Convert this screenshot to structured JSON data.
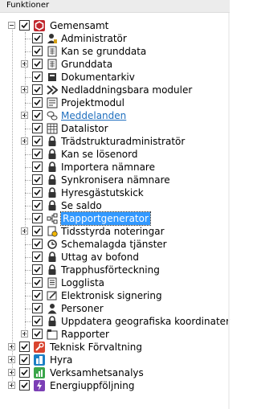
{
  "panel": {
    "title": "Funktioner"
  },
  "tree": {
    "root": {
      "label": "Gemensamt",
      "icon": "gemensamt-icon"
    },
    "children": [
      {
        "label": "Administratör",
        "icon": "admin-user-icon"
      },
      {
        "label": "Kan se grunddata",
        "icon": "document-grid-icon"
      },
      {
        "label": "Grunddata",
        "icon": "document-grid-icon"
      },
      {
        "label": "Dokumentarkiv",
        "icon": "archive-book-icon"
      },
      {
        "label": "Nedladdningsbara moduler",
        "icon": "download-arrow-icon"
      },
      {
        "label": "Projektmodul",
        "icon": "project-list-icon"
      },
      {
        "label": "Meddelanden",
        "icon": "message-bubbles-icon"
      },
      {
        "label": "Datalistor",
        "icon": "table-grid-icon"
      },
      {
        "label": "Trädstrukturadministratör",
        "icon": "lock-icon"
      },
      {
        "label": "Kan se lösenord",
        "icon": "lock-icon"
      },
      {
        "label": "Importera nämnare",
        "icon": "lock-icon"
      },
      {
        "label": "Synkronisera nämnare",
        "icon": "lock-icon"
      },
      {
        "label": "Hyresgästutskick",
        "icon": "lock-icon"
      },
      {
        "label": "Se saldo",
        "icon": "lock-icon"
      },
      {
        "label": "Rapportgenerator",
        "icon": "report-nodes-icon"
      },
      {
        "label": "Tidsstyrda noteringar",
        "icon": "timed-note-icon"
      },
      {
        "label": "Schemalagda tjänster",
        "icon": "scheduled-services-icon"
      },
      {
        "label": "Uttag av bofond",
        "icon": "lock-icon"
      },
      {
        "label": "Trapphusförteckning",
        "icon": "lock-icon"
      },
      {
        "label": "Logglista",
        "icon": "log-list-icon"
      },
      {
        "label": "Elektronisk signering",
        "icon": "signature-pen-icon"
      },
      {
        "label": "Personer",
        "icon": "person-icon"
      },
      {
        "label": "Uppdatera geografiska koordinater",
        "icon": "lock-icon"
      },
      {
        "label": "Rapporter",
        "icon": "reports-folder-icon"
      }
    ],
    "top_level": [
      {
        "label": "Teknisk Förvaltning",
        "icon": "wrench-icon"
      },
      {
        "label": "Hyra",
        "icon": "buildings-icon"
      },
      {
        "label": "Verksamhetsanalys",
        "icon": "bar-chart-icon"
      },
      {
        "label": "Energiuppföljning",
        "icon": "lightning-icon"
      }
    ],
    "selected": "Rapportgenerator",
    "colors": {
      "selection": "#3399ff",
      "link": "#1f6fbf",
      "gemensamt": "#c0262d",
      "teknisk": "#d9442f",
      "hyra": "#1b7fc4",
      "verksamhet": "#3aa64a",
      "energi": "#7b3fb5"
    }
  }
}
